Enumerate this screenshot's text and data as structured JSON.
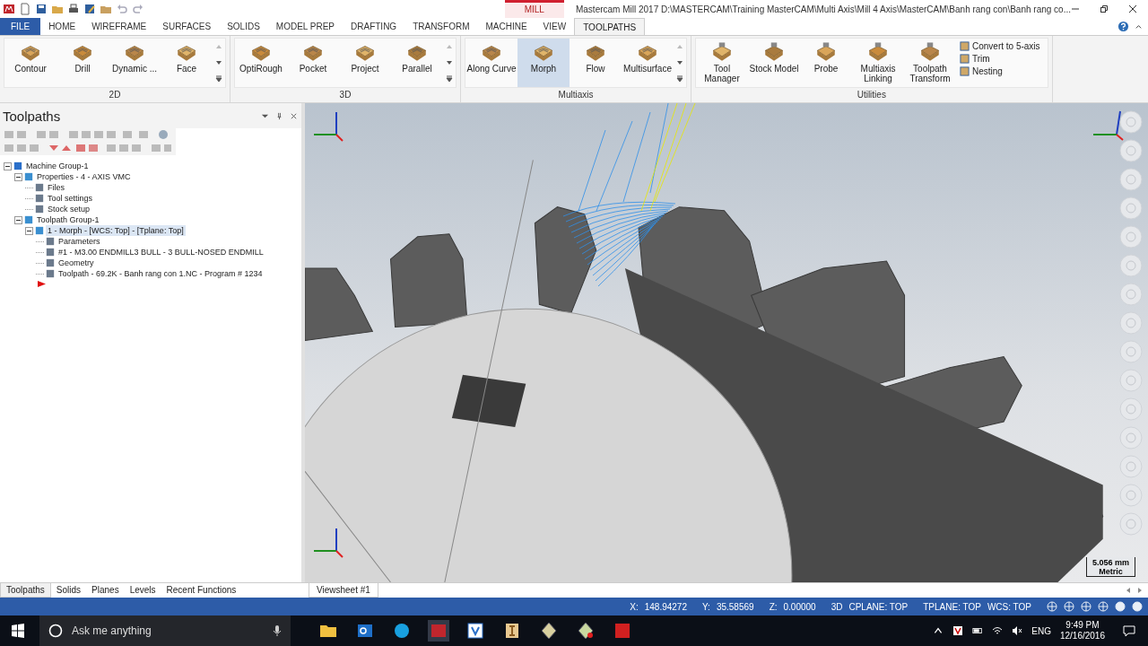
{
  "title_bar": {
    "context_tab": "MILL",
    "title": "Mastercam Mill 2017  D:\\MASTERCAM\\Training MasterCAM\\Multi Axis\\Mill 4 Axis\\MasterCAM\\Banh rang con\\Banh rang co..."
  },
  "ribbon_tabs": [
    {
      "label": "FILE",
      "kind": "file",
      "selected": false
    },
    {
      "label": "HOME",
      "kind": "tab",
      "selected": false
    },
    {
      "label": "WIREFRAME",
      "kind": "tab",
      "selected": false
    },
    {
      "label": "SURFACES",
      "kind": "tab",
      "selected": false
    },
    {
      "label": "SOLIDS",
      "kind": "tab",
      "selected": false
    },
    {
      "label": "MODEL PREP",
      "kind": "tab",
      "selected": false
    },
    {
      "label": "DRAFTING",
      "kind": "tab",
      "selected": false
    },
    {
      "label": "TRANSFORM",
      "kind": "tab",
      "selected": false
    },
    {
      "label": "MACHINE",
      "kind": "tab",
      "selected": false
    },
    {
      "label": "VIEW",
      "kind": "tab",
      "selected": false
    },
    {
      "label": "TOOLPATHS",
      "kind": "tab",
      "selected": true
    }
  ],
  "ribbon_groups": [
    {
      "label": "2D",
      "scroll": true,
      "buttons": [
        {
          "label": "Contour",
          "selected": false
        },
        {
          "label": "Drill",
          "selected": false
        },
        {
          "label": "Dynamic ...",
          "selected": false
        },
        {
          "label": "Face",
          "selected": false
        }
      ]
    },
    {
      "label": "3D",
      "scroll": true,
      "buttons": [
        {
          "label": "OptiRough",
          "selected": false
        },
        {
          "label": "Pocket",
          "selected": false
        },
        {
          "label": "Project",
          "selected": false
        },
        {
          "label": "Parallel",
          "selected": false
        }
      ]
    },
    {
      "label": "Multiaxis",
      "scroll": true,
      "buttons": [
        {
          "label": "Along Curve",
          "selected": false
        },
        {
          "label": "Morph",
          "selected": true
        },
        {
          "label": "Flow",
          "selected": false
        },
        {
          "label": "Multisurface",
          "selected": false
        }
      ]
    },
    {
      "label": "Utilities",
      "buttons": [
        {
          "label": "Tool Manager",
          "selected": false
        },
        {
          "label": "Stock Model",
          "selected": false
        },
        {
          "label": "Probe",
          "selected": false
        },
        {
          "label": "Multiaxis Linking",
          "selected": false
        },
        {
          "label": "Toolpath Transform",
          "selected": false
        }
      ],
      "small_buttons": [
        "Convert to 5-axis",
        "Trim",
        "Nesting"
      ]
    }
  ],
  "panel": {
    "title": "Toolpaths",
    "tree": [
      {
        "label": "Machine Group-1",
        "expanded": true,
        "selected": false,
        "children": [
          {
            "label": "Properties - 4 - AXIS VMC",
            "expanded": true,
            "selected": false,
            "children": [
              {
                "label": "Files",
                "selected": false
              },
              {
                "label": "Tool settings",
                "selected": false
              },
              {
                "label": "Stock setup",
                "selected": false
              }
            ]
          },
          {
            "label": "Toolpath Group-1",
            "expanded": true,
            "selected": false,
            "children": [
              {
                "label": "1 - Morph - [WCS: Top] - [Tplane: Top]",
                "expanded": true,
                "selected": true,
                "children": [
                  {
                    "label": "Parameters",
                    "selected": false
                  },
                  {
                    "label": "#1 - M3.00 ENDMILL3 BULL - 3 BULL-NOSED ENDMILL",
                    "selected": false
                  },
                  {
                    "label": "Geometry",
                    "selected": false
                  },
                  {
                    "label": "Toolpath - 69.2K - Banh rang con 1.NC - Program # 1234",
                    "selected": false
                  }
                ]
              }
            ]
          }
        ]
      }
    ]
  },
  "viewport": {
    "scale": "5.056 mm",
    "units": "Metric"
  },
  "bottom_tabs": [
    {
      "label": "Toolpaths",
      "selected": true
    },
    {
      "label": "Solids",
      "selected": false
    },
    {
      "label": "Planes",
      "selected": false
    },
    {
      "label": "Levels",
      "selected": false
    },
    {
      "label": "Recent Functions",
      "selected": false
    }
  ],
  "viewsheet_tab": "Viewsheet #1",
  "status_bar": [
    {
      "label": "X:",
      "value": "148.94272"
    },
    {
      "label": "Y:",
      "value": "35.58569"
    },
    {
      "label": "Z:",
      "value": "0.00000"
    },
    {
      "label": "3D",
      "value": "CPLANE: TOP"
    },
    {
      "label": "TPLANE: TOP",
      "value": "WCS: TOP"
    }
  ],
  "taskbar": {
    "search_placeholder": "Ask me anything",
    "language": "ENG",
    "time": "9:49 PM",
    "date": "12/16/2016"
  }
}
